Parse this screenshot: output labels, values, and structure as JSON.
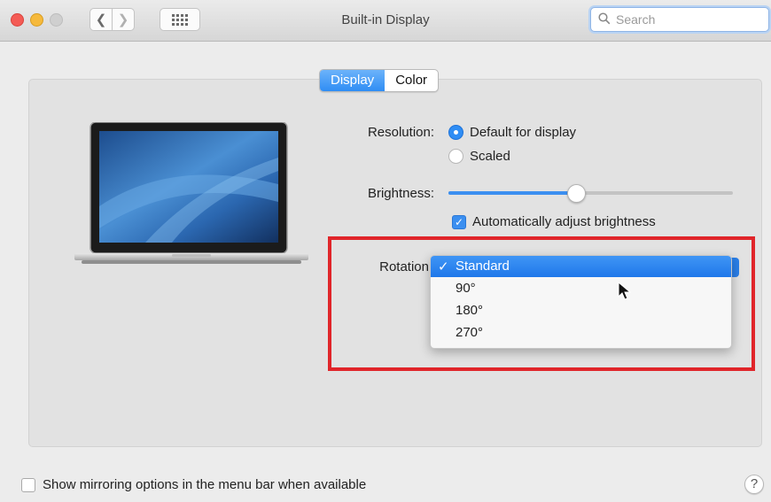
{
  "window": {
    "title": "Built-in Display",
    "search_placeholder": "Search"
  },
  "toolbar": {
    "back_glyph": "❮",
    "forward_glyph": "❯",
    "grid_icon": "grid-icon"
  },
  "tabs": [
    {
      "label": "Display",
      "active": true
    },
    {
      "label": "Color",
      "active": false
    }
  ],
  "resolution": {
    "label": "Resolution:",
    "options": [
      {
        "label": "Default for display",
        "selected": true
      },
      {
        "label": "Scaled",
        "selected": false
      }
    ]
  },
  "brightness": {
    "label": "Brightness:",
    "level": 0.45,
    "auto_label": "Automatically adjust brightness",
    "auto_checked": true
  },
  "rotation": {
    "label": "Rotation",
    "options": [
      {
        "label": "Standard",
        "selected": true
      },
      {
        "label": "90°",
        "selected": false
      },
      {
        "label": "180°",
        "selected": false
      },
      {
        "label": "270°",
        "selected": false
      }
    ],
    "checkmark": "✓"
  },
  "footer": {
    "mirroring_label": "Show mirroring options in the menu bar when available",
    "mirroring_checked": false,
    "help_label": "?"
  },
  "colors": {
    "accent": "#2f8df4",
    "highlight_box": "#e0252a"
  }
}
